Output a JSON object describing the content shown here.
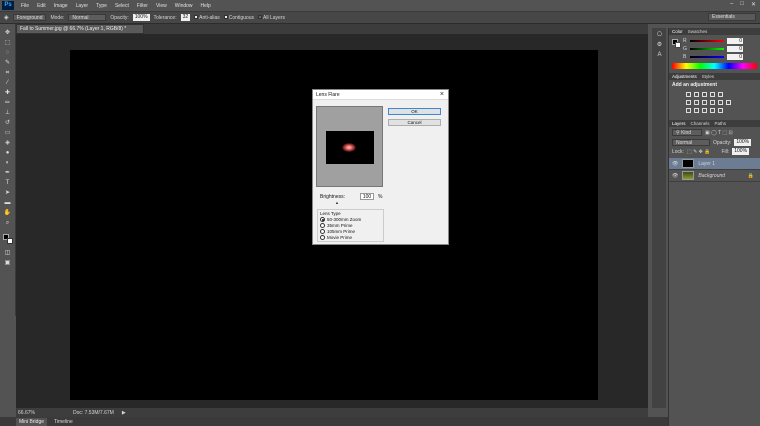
{
  "app": {
    "logo": "Ps"
  },
  "menu": [
    "File",
    "Edit",
    "Image",
    "Layer",
    "Type",
    "Select",
    "Filter",
    "View",
    "Window",
    "Help"
  ],
  "window_controls": {
    "minimize": "–",
    "maximize": "□",
    "close": "✕"
  },
  "options_bar": {
    "tool_preset_icon": "paint-bucket-icon",
    "source": "Foreground",
    "mode_label": "Mode:",
    "mode_value": "Normal",
    "opacity_label": "Opacity:",
    "opacity_value": "100%",
    "tolerance_label": "Tolerance:",
    "tolerance_value": "32",
    "anti_alias": "Anti-alias",
    "contiguous": "Contiguous",
    "all_layers": "All Layers"
  },
  "workspace": "Essentials",
  "document_tab": "Fall to Summer.jpg @ 66.7% (Layer 1, RGB/8) *",
  "status": {
    "zoom": "66.67%",
    "doc": "Doc: 7.53M/7.67M"
  },
  "bottom_tabs": [
    "Mini Bridge",
    "Timeline"
  ],
  "color_panel": {
    "tabs": [
      "Color",
      "Swatches"
    ],
    "r": {
      "label": "R",
      "value": "0"
    },
    "g": {
      "label": "G",
      "value": "0"
    },
    "b": {
      "label": "B",
      "value": "0"
    }
  },
  "adjustments_panel": {
    "tabs": [
      "Adjustments",
      "Styles"
    ],
    "heading": "Add an adjustment"
  },
  "layers_panel": {
    "tabs": [
      "Layers",
      "Channels",
      "Paths"
    ],
    "kind": "Kind",
    "blend": "Normal",
    "opacity_label": "Opacity:",
    "opacity_value": "100%",
    "lock_label": "Lock:",
    "fill_label": "Fill:",
    "fill_value": "100%",
    "layers": [
      {
        "name": "Layer 1",
        "selected": true
      },
      {
        "name": "Background",
        "selected": false
      }
    ]
  },
  "dialog": {
    "title": "Lens Flare",
    "ok": "OK",
    "cancel": "Cancel",
    "brightness_label": "Brightness:",
    "brightness_value": "100",
    "brightness_unit": "%",
    "lens_type_label": "Lens Type",
    "lens_options": [
      "50-300mm Zoom",
      "35mm Prime",
      "105mm Prime",
      "Movie Prime"
    ],
    "selected_lens": "50-300mm Zoom"
  },
  "colors": {
    "accent_ok": "#3a89d8",
    "flare": "#e05050"
  }
}
